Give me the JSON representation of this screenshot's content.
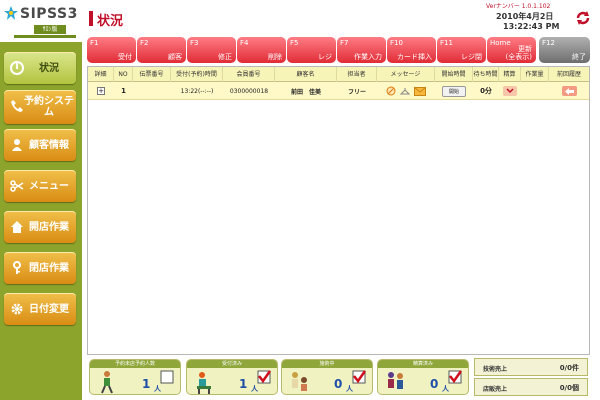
{
  "app": {
    "logo_text": "SIPSS3",
    "logo_sub": "ｻﾛﾝ版"
  },
  "header": {
    "title": "状況",
    "version": "Verナンバー 1.0.1.102",
    "date": "2010年4月2日",
    "time": "13:22:43 PM"
  },
  "sidebar": {
    "items": [
      {
        "label": "状況",
        "icon": "power-icon"
      },
      {
        "label": "予約システム",
        "icon": "phone-icon"
      },
      {
        "label": "顧客情報",
        "icon": "person-icon"
      },
      {
        "label": "メニュー",
        "icon": "scissors-icon"
      },
      {
        "label": "開店作業",
        "icon": "house-icon"
      },
      {
        "label": "閉店作業",
        "icon": "key-icon"
      },
      {
        "label": "日付変更",
        "icon": "gear-icon"
      }
    ]
  },
  "function_keys": [
    {
      "key": "F1",
      "label": "受付"
    },
    {
      "key": "F2",
      "label": "顧客"
    },
    {
      "key": "F3",
      "label": "修正"
    },
    {
      "key": "F4",
      "label": "削除"
    },
    {
      "key": "F5",
      "label": "レジ"
    },
    {
      "key": "F7",
      "label": "作業入力"
    },
    {
      "key": "F10",
      "label": "カード挿入"
    },
    {
      "key": "F11",
      "label": "レジ閉"
    },
    {
      "key": "Home",
      "label": "更新\n(全表示)"
    },
    {
      "key": "F12",
      "label": "終了"
    }
  ],
  "table": {
    "columns": [
      "詳細",
      "NO",
      "伝票番号",
      "受付(予約)時間",
      "会員番号",
      "顧客名",
      "担当者",
      "メッセージ",
      "開始時間",
      "待ち時間",
      "精算",
      "作業量",
      "前回履歴"
    ],
    "rows": [
      {
        "detail": "+",
        "no": "1",
        "slip": "",
        "reception": "13:22(--:--)",
        "member": "0300000018",
        "customer": "前田　佳美",
        "staff": "フリー",
        "start": "開始",
        "wait": "0分"
      }
    ]
  },
  "status": [
    {
      "label": "予約未店予約人数",
      "value": "1",
      "unit": "人"
    },
    {
      "label": "受付済み",
      "value": "1",
      "unit": "人"
    },
    {
      "label": "施術中",
      "value": "0",
      "unit": "人"
    },
    {
      "label": "精算済み",
      "value": "0",
      "unit": "人"
    }
  ],
  "sales": [
    {
      "label": "技術売上",
      "value": "0/0件"
    },
    {
      "label": "店販売上",
      "value": "0/0個"
    }
  ],
  "colors": {
    "accent": "#c0102a",
    "sidebar": "#8da42c",
    "button": "#e8a02a",
    "fkey": "#e02c36"
  }
}
